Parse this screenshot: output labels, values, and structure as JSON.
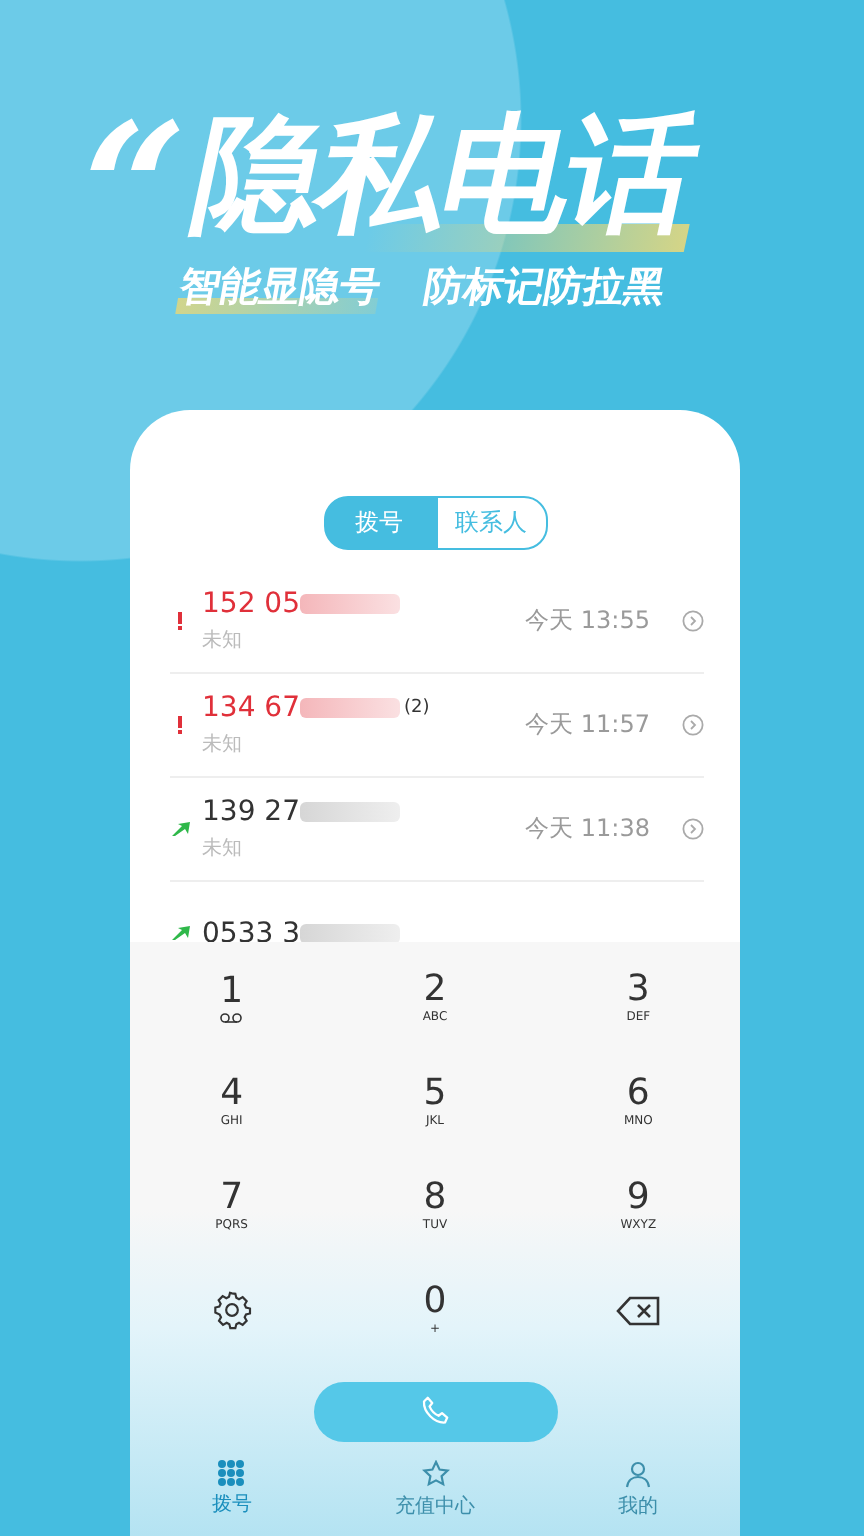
{
  "headline": {
    "quote": "“",
    "title": "隐私电话"
  },
  "subtitles": [
    "智能显隐号",
    "防标记防拉黑"
  ],
  "tabs": [
    {
      "label": "拨号",
      "selected": true
    },
    {
      "label": "联系人",
      "selected": false
    }
  ],
  "calls": [
    {
      "kind": "missed",
      "number": "152 05",
      "label": "未知",
      "time": "今天 13:55"
    },
    {
      "kind": "missed",
      "number": "134 67",
      "count": "(2)",
      "label": "未知",
      "time": "今天 11:57"
    },
    {
      "kind": "outgoing",
      "number": "139 27",
      "label": "未知",
      "time": "今天 11:38"
    },
    {
      "kind": "outgoing",
      "number": "0533 3"
    }
  ],
  "keypad": [
    {
      "kind": "voicemail",
      "digit": "1"
    },
    {
      "kind": "digit",
      "digit": "2",
      "letters": "ABC"
    },
    {
      "kind": "digit",
      "digit": "3",
      "letters": "DEF"
    },
    {
      "kind": "digit",
      "digit": "4",
      "letters": "GHI"
    },
    {
      "kind": "digit",
      "digit": "5",
      "letters": "JKL"
    },
    {
      "kind": "digit",
      "digit": "6",
      "letters": "MNO"
    },
    {
      "kind": "digit",
      "digit": "7",
      "letters": "PQRS"
    },
    {
      "kind": "digit",
      "digit": "8",
      "letters": "TUV"
    },
    {
      "kind": "digit",
      "digit": "9",
      "letters": "WXYZ"
    },
    {
      "kind": "settings"
    },
    {
      "kind": "digit",
      "digit": "0",
      "letters": "+"
    },
    {
      "kind": "delete"
    }
  ],
  "nav": [
    {
      "kind": "dialpad",
      "label": "拨号",
      "selected": true
    },
    {
      "kind": "star",
      "label": "充值中心",
      "selected": false
    },
    {
      "kind": "person",
      "label": "我的",
      "selected": false
    }
  ]
}
